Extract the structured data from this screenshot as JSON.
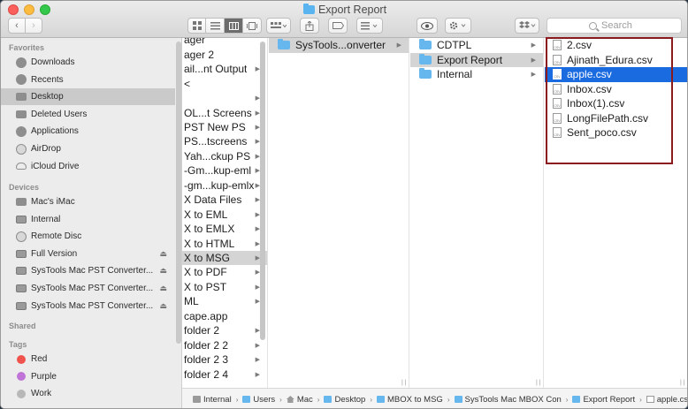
{
  "window": {
    "title": "Export Report"
  },
  "toolbar": {
    "search_placeholder": "Search",
    "back_glyph": "‹",
    "forward_glyph": "›"
  },
  "sidebar": {
    "favorites_header": "Favorites",
    "favorites": [
      {
        "label": "Downloads",
        "icon": "downloads-icon"
      },
      {
        "label": "Recents",
        "icon": "recents-icon"
      },
      {
        "label": "Desktop",
        "icon": "desktop-icon",
        "selected": true
      },
      {
        "label": "Deleted Users",
        "icon": "folder-icon"
      },
      {
        "label": "Applications",
        "icon": "applications-icon"
      },
      {
        "label": "AirDrop",
        "icon": "airdrop-icon"
      },
      {
        "label": "iCloud Drive",
        "icon": "icloud-icon"
      }
    ],
    "devices_header": "Devices",
    "devices": [
      {
        "label": "Mac's iMac",
        "icon": "imac-icon"
      },
      {
        "label": "Internal",
        "icon": "drive-icon"
      },
      {
        "label": "Remote Disc",
        "icon": "disc-icon"
      },
      {
        "label": "Full Version",
        "icon": "drive-icon",
        "eject": true
      },
      {
        "label": "SysTools Mac PST Converter...",
        "icon": "drive-icon",
        "eject": true
      },
      {
        "label": "SysTools Mac PST Converter...",
        "icon": "drive-icon",
        "eject": true
      },
      {
        "label": "SysTools Mac PST Converter...",
        "icon": "drive-icon",
        "eject": true
      }
    ],
    "shared_header": "Shared",
    "tags_header": "Tags",
    "tags": [
      {
        "label": "Red",
        "color": "#f0534e"
      },
      {
        "label": "Purple",
        "color": "#c074d8"
      },
      {
        "label": "Work",
        "color": "#b8b8b8"
      }
    ],
    "eject_glyph": "⏏"
  },
  "columns": {
    "col1": [
      {
        "label": "ager"
      },
      {
        "label": "ager 2"
      },
      {
        "label": "ail...nt Output",
        "arrow": true
      },
      {
        "label": "<"
      },
      {
        "label": "",
        "arrow": true
      },
      {
        "label": "OL...t Screens",
        "arrow": true
      },
      {
        "label": "PST New PS",
        "arrow": true
      },
      {
        "label": "PS...tscreens",
        "arrow": true
      },
      {
        "label": "Yah...ckup PS",
        "arrow": true
      },
      {
        "label": "-Gm...kup-eml",
        "arrow": true
      },
      {
        "label": "-gm...kup-emlx",
        "arrow": true
      },
      {
        "label": "X Data Files",
        "arrow": true
      },
      {
        "label": "X to EML",
        "arrow": true
      },
      {
        "label": "X to EMLX",
        "arrow": true
      },
      {
        "label": "X to HTML",
        "arrow": true
      },
      {
        "label": "X to MSG",
        "arrow": true,
        "selected": true
      },
      {
        "label": "X to PDF",
        "arrow": true
      },
      {
        "label": "X to PST",
        "arrow": true
      },
      {
        "label": "ML",
        "arrow": true
      },
      {
        "label": "cape.app"
      },
      {
        "label": "folder 2",
        "arrow": true
      },
      {
        "label": "folder 2 2",
        "arrow": true
      },
      {
        "label": "folder 2 3",
        "arrow": true
      },
      {
        "label": "folder 2 4",
        "arrow": true
      }
    ],
    "col2": [
      {
        "label": "SysTools...onverter",
        "arrow": true,
        "selected": true
      }
    ],
    "col3": [
      {
        "label": "CDTPL",
        "arrow": true
      },
      {
        "label": "Export Report",
        "arrow": true,
        "selected": true
      },
      {
        "label": "Internal",
        "arrow": true
      }
    ],
    "col4": [
      {
        "label": "2.csv"
      },
      {
        "label": "Ajinath_Edura.csv"
      },
      {
        "label": "apple.csv",
        "selected": true
      },
      {
        "label": "Inbox.csv"
      },
      {
        "label": "Inbox(1).csv"
      },
      {
        "label": "LongFilePath.csv"
      },
      {
        "label": "Sent_poco.csv"
      }
    ],
    "csv_badge": "CSV",
    "arrow_glyph": "▶"
  },
  "pathbar": {
    "separator": "›",
    "crumbs": [
      {
        "label": "Internal",
        "icon": "drive-icon"
      },
      {
        "label": "Users",
        "icon": "folder-icon"
      },
      {
        "label": "Mac",
        "icon": "home-icon"
      },
      {
        "label": "Desktop",
        "icon": "folder-icon"
      },
      {
        "label": "MBOX to MSG",
        "icon": "folder-icon"
      },
      {
        "label": "SysTools Mac MBOX Con",
        "icon": "folder-icon"
      },
      {
        "label": "Export Report",
        "icon": "folder-icon"
      },
      {
        "label": "apple.csv",
        "icon": "file-icon"
      }
    ]
  }
}
